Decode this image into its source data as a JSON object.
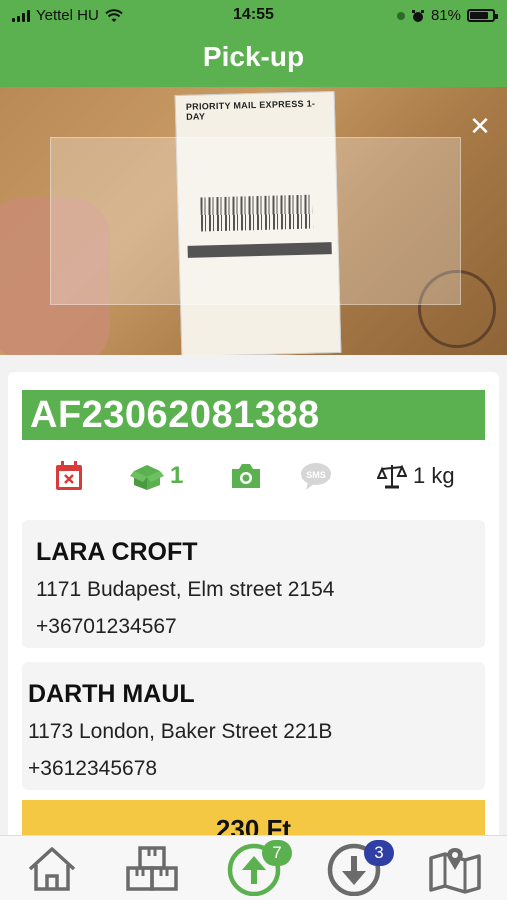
{
  "statusbar": {
    "carrier": "Yettel HU",
    "time": "14:55",
    "battery": "81%"
  },
  "header": {
    "title": "Pick-up"
  },
  "camera": {
    "label_header": "PRIORITY MAIL EXPRESS 1-DAY"
  },
  "shipment": {
    "code": "AF23062081388",
    "package_count": "1",
    "weight": "1 kg"
  },
  "sender": {
    "name": "LARA CROFT",
    "address": "1171 Budapest, Elm street 2154",
    "phone": "+36701234567"
  },
  "recipient": {
    "name": "DARTH MAUL",
    "address": "1173 London, Baker Street 221B",
    "phone": "+3612345678"
  },
  "price": "230 Ft",
  "tabs": {
    "pickup_badge": "7",
    "delivery_badge": "3"
  },
  "colors": {
    "brand_green": "#5bb04f",
    "alert_red": "#d93a3a",
    "price_yellow": "#f4c842",
    "badge_blue": "#2f3fa3"
  }
}
